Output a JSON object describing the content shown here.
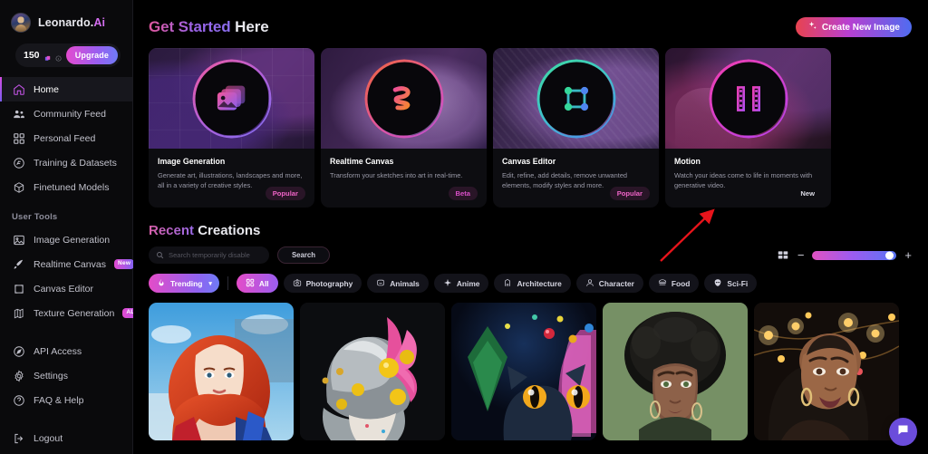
{
  "sidebar": {
    "brand": {
      "name": "Leonardo.",
      "suffix": "Ai",
      "avatar_icon": "user-avatar"
    },
    "credits": {
      "amount": "150",
      "coin_icon": "token-icon",
      "info_icon": "info-icon",
      "upgrade_label": "Upgrade"
    },
    "nav": [
      {
        "label": "Home",
        "icon": "home-icon",
        "active": true
      },
      {
        "label": "Community Feed",
        "icon": "community-icon",
        "active": false
      },
      {
        "label": "Personal Feed",
        "icon": "grid-squares-icon",
        "active": false
      },
      {
        "label": "Training & Datasets",
        "icon": "training-icon",
        "active": false
      },
      {
        "label": "Finetuned Models",
        "icon": "cube-icon",
        "active": false
      }
    ],
    "user_tools_label": "User Tools",
    "tools": [
      {
        "label": "Image Generation",
        "icon": "image-icon",
        "badge": ""
      },
      {
        "label": "Realtime Canvas",
        "icon": "brush-icon",
        "badge": "New"
      },
      {
        "label": "Canvas Editor",
        "icon": "frame-icon",
        "badge": ""
      },
      {
        "label": "Texture Generation",
        "icon": "texture-icon",
        "badge": "ALPHA"
      }
    ],
    "footer": [
      {
        "label": "API Access",
        "icon": "compass-icon"
      },
      {
        "label": "Settings",
        "icon": "gear-icon"
      },
      {
        "label": "FAQ & Help",
        "icon": "question-icon"
      },
      {
        "label": "Logout",
        "icon": "logout-icon"
      }
    ]
  },
  "header": {
    "title_accent": "Get Started",
    "title_rest": " Here",
    "create_button": {
      "label": "Create New Image",
      "icon": "sparkle-icon"
    }
  },
  "cards": [
    {
      "title": "Image Generation",
      "desc": "Generate art, illustrations, landscapes and more, all in a variety of creative styles.",
      "tag": "Popular",
      "tag_kind": "popular",
      "icon": "photos-stack-icon",
      "ring_from": "#f25ba0",
      "ring_to": "#7f6ff2"
    },
    {
      "title": "Realtime Canvas",
      "desc": "Transform your sketches into art in real-time.",
      "tag": "Beta",
      "tag_kind": "beta",
      "icon": "squiggle-icon",
      "ring_from": "#f0663a",
      "ring_to": "#d855c8"
    },
    {
      "title": "Canvas Editor",
      "desc": "Edit, refine, add details, remove unwanted elements, modify styles and more.",
      "tag": "Popular",
      "tag_kind": "popular",
      "icon": "bounding-box-icon",
      "ring_from": "#3ddba0",
      "ring_to": "#4f86f0"
    },
    {
      "title": "Motion",
      "desc": "Watch your ideas come to life in moments with generative video.",
      "tag": "New",
      "tag_kind": "new",
      "icon": "film-strip-icon",
      "ring_from": "#f03fb0",
      "ring_to": "#c23ff0"
    }
  ],
  "recent": {
    "title_accent": "Recent",
    "title_rest": " Creations",
    "search": {
      "placeholder": "Search temporarily disable",
      "value": "",
      "icon": "search-icon"
    },
    "search_button": "Search",
    "view": {
      "grid_icon": "grid-view-icon",
      "minus_label": "−",
      "plus_label": "+",
      "slider_value": 93
    },
    "chips": [
      {
        "label": "Trending",
        "icon": "flame-icon",
        "style": "trending",
        "caret": "▾"
      },
      {
        "label": "All",
        "icon": "grid-squares-icon",
        "style": "all"
      },
      {
        "label": "Photography",
        "icon": "camera-icon",
        "style": "plain"
      },
      {
        "label": "Animals",
        "icon": "paw-icon",
        "style": "plain"
      },
      {
        "label": "Anime",
        "icon": "sparkle-icon",
        "style": "plain"
      },
      {
        "label": "Architecture",
        "icon": "building-icon",
        "style": "plain"
      },
      {
        "label": "Character",
        "icon": "person-icon",
        "style": "plain"
      },
      {
        "label": "Food",
        "icon": "burger-icon",
        "style": "plain"
      },
      {
        "label": "Sci-Fi",
        "icon": "alien-icon",
        "style": "plain"
      }
    ],
    "gallery": [
      {
        "alt": "red-haired anime woman in blue and red outfit"
      },
      {
        "alt": "silver-haired figure with pink feathers and gold bells"
      },
      {
        "alt": "blue cat with orange eyes beside christmas tree"
      },
      {
        "alt": "woman with large afro on green background"
      },
      {
        "alt": "smiling woman with warm bokeh string lights"
      }
    ]
  },
  "annotation": {
    "arrow_color": "#e8141b",
    "points_to": "Motion card"
  },
  "intercom": {
    "icon": "chat-bubble-icon",
    "color": "#6b4ddb"
  }
}
